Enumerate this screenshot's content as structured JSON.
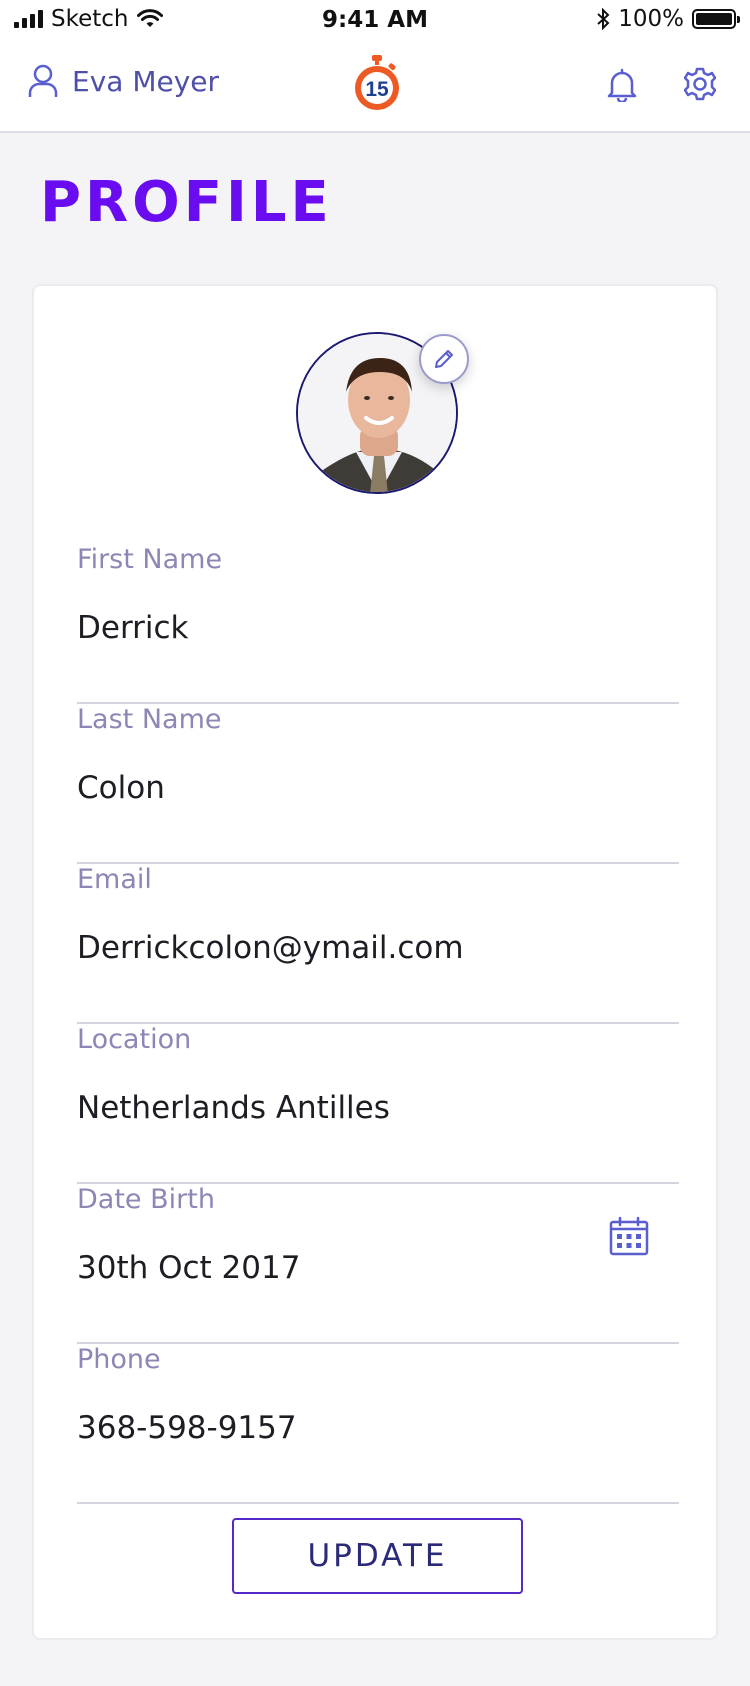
{
  "status_bar": {
    "carrier": "Sketch",
    "time": "9:41 AM",
    "battery_percent": "100%",
    "battery_level": 1.0
  },
  "nav": {
    "user_name": "Eva Meyer",
    "logo_number": "15"
  },
  "page": {
    "title": "PROFILE"
  },
  "form": {
    "fields": [
      {
        "label": "First Name",
        "value": "Derrick"
      },
      {
        "label": "Last Name",
        "value": "Colon"
      },
      {
        "label": "Email",
        "value": "Derrickcolon@ymail.com"
      },
      {
        "label": "Location",
        "value": "Netherlands Antilles"
      },
      {
        "label": "Date Birth",
        "value": "30th Oct 2017"
      },
      {
        "label": "Phone",
        "value": "368-598-9157"
      }
    ],
    "update_label": "UPDATE"
  },
  "colors": {
    "accent": "#6a0cf0",
    "nav_icon": "#5a5fd0",
    "label": "#8c87b5",
    "logo_orange": "#ee5a24",
    "logo_blue": "#1f3f8f"
  },
  "icons": {
    "user": "user-icon",
    "bell": "bell-icon",
    "gear": "gear-icon",
    "edit": "pencil-icon",
    "calendar": "calendar-icon"
  }
}
